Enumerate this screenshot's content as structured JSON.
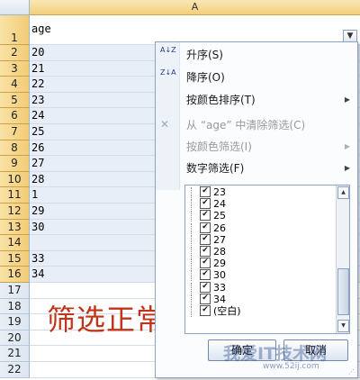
{
  "sheet": {
    "column_header": "A",
    "rows": [
      {
        "num": "1",
        "value": "age"
      },
      {
        "num": "2",
        "value": "20"
      },
      {
        "num": "3",
        "value": "21"
      },
      {
        "num": "4",
        "value": "22"
      },
      {
        "num": "5",
        "value": "23"
      },
      {
        "num": "6",
        "value": "24"
      },
      {
        "num": "7",
        "value": "25"
      },
      {
        "num": "8",
        "value": "26"
      },
      {
        "num": "9",
        "value": "27"
      },
      {
        "num": "10",
        "value": "28"
      },
      {
        "num": "11",
        "value": "1"
      },
      {
        "num": "12",
        "value": "29"
      },
      {
        "num": "13",
        "value": "30"
      },
      {
        "num": "14",
        "value": ""
      },
      {
        "num": "15",
        "value": "33"
      },
      {
        "num": "16",
        "value": "34"
      },
      {
        "num": "17",
        "value": ""
      },
      {
        "num": "18",
        "value": ""
      },
      {
        "num": "19",
        "value": ""
      },
      {
        "num": "20",
        "value": ""
      },
      {
        "num": "21",
        "value": ""
      },
      {
        "num": "22",
        "value": ""
      }
    ],
    "annotation": "筛选正常"
  },
  "menu": {
    "items": [
      {
        "label": "升序(S)",
        "icon": "sort-ascending-icon",
        "icon_glyph": "A↓Z",
        "disabled": false,
        "submenu": false
      },
      {
        "label": "降序(O)",
        "icon": "sort-descending-icon",
        "icon_glyph": "Z↓A",
        "disabled": false,
        "submenu": false
      },
      {
        "label": "按颜色排序(T)",
        "icon": "",
        "disabled": false,
        "submenu": true
      },
      {
        "label": "从 “age” 中清除筛选(C)",
        "icon": "clear-filter-icon",
        "icon_glyph": "✕",
        "disabled": true,
        "submenu": false
      },
      {
        "label": "按颜色筛选(I)",
        "icon": "",
        "disabled": true,
        "submenu": true
      },
      {
        "label": "数字筛选(F)",
        "icon": "",
        "disabled": false,
        "submenu": true
      }
    ],
    "values": [
      {
        "label": "23",
        "checked": true
      },
      {
        "label": "24",
        "checked": true
      },
      {
        "label": "25",
        "checked": true
      },
      {
        "label": "26",
        "checked": true
      },
      {
        "label": "27",
        "checked": true
      },
      {
        "label": "28",
        "checked": true
      },
      {
        "label": "29",
        "checked": true
      },
      {
        "label": "30",
        "checked": true
      },
      {
        "label": "33",
        "checked": true
      },
      {
        "label": "34",
        "checked": true
      },
      {
        "label": "(空白)",
        "checked": true
      }
    ],
    "ok_label": "确定",
    "cancel_label": "取消"
  },
  "watermark": {
    "text": "我爱IT技术网",
    "url": "www.52ij.com"
  },
  "colors": {
    "annotation": "#c0351a",
    "header_selected": "#f2cc77"
  }
}
